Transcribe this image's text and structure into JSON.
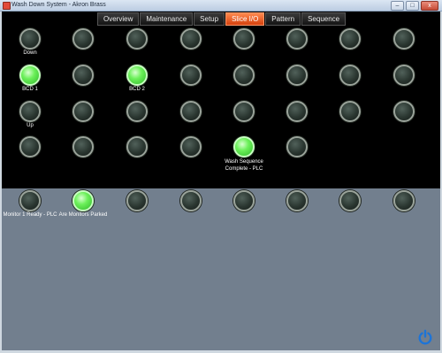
{
  "window": {
    "title": "Wash Down System - Akron Brass",
    "buttons": {
      "minimize": "–",
      "maximize": "□",
      "close": "x"
    }
  },
  "tabs": [
    {
      "label": "Overview",
      "active": false
    },
    {
      "label": "Maintenance",
      "active": false
    },
    {
      "label": "Setup",
      "active": false
    },
    {
      "label": "Slice I/O",
      "active": true
    },
    {
      "label": "Pattern",
      "active": false
    },
    {
      "label": "Sequence",
      "active": false
    }
  ],
  "indicators": {
    "row1": [
      {
        "label": "Down",
        "on": false
      },
      {
        "label": "",
        "on": false
      },
      {
        "label": "",
        "on": false
      },
      {
        "label": "",
        "on": false
      },
      {
        "label": "",
        "on": false
      },
      {
        "label": "",
        "on": false
      },
      {
        "label": "",
        "on": false
      },
      {
        "label": "",
        "on": false
      }
    ],
    "row2": [
      {
        "label": "BCD 1",
        "on": true
      },
      {
        "label": "",
        "on": false
      },
      {
        "label": "BCD 2",
        "on": true
      },
      {
        "label": "",
        "on": false
      },
      {
        "label": "",
        "on": false
      },
      {
        "label": "",
        "on": false
      },
      {
        "label": "",
        "on": false
      },
      {
        "label": "",
        "on": false
      }
    ],
    "row3": [
      {
        "label": "Up",
        "on": false
      },
      {
        "label": "",
        "on": false
      },
      {
        "label": "",
        "on": false
      },
      {
        "label": "",
        "on": false
      },
      {
        "label": "",
        "on": false
      },
      {
        "label": "",
        "on": false
      },
      {
        "label": "",
        "on": false
      },
      {
        "label": "",
        "on": false
      }
    ],
    "row4": [
      {
        "label": "",
        "on": false
      },
      {
        "label": "",
        "on": false
      },
      {
        "label": "",
        "on": false
      },
      {
        "label": "",
        "on": false
      },
      {
        "label": "Wash Sequence",
        "label2": "Complete - PLC",
        "on": true
      },
      {
        "label": "",
        "on": false
      }
    ],
    "row5": [
      {
        "label": "Monitor 1 Ready - PLC",
        "on": false
      },
      {
        "label": "Are Monitors Parked",
        "on": true
      },
      {
        "label": "",
        "on": false
      },
      {
        "label": "",
        "on": false
      },
      {
        "label": "",
        "on": false
      },
      {
        "label": "",
        "on": false
      },
      {
        "label": "",
        "on": false
      },
      {
        "label": "",
        "on": false
      }
    ]
  },
  "colors": {
    "accent": "#f0601e",
    "led_on": "#5fe24f",
    "led_off": "#2e3a34",
    "panel_bottom": "#727f8e",
    "power_icon": "#1c74d8"
  },
  "power": {
    "icon": "power-icon"
  }
}
